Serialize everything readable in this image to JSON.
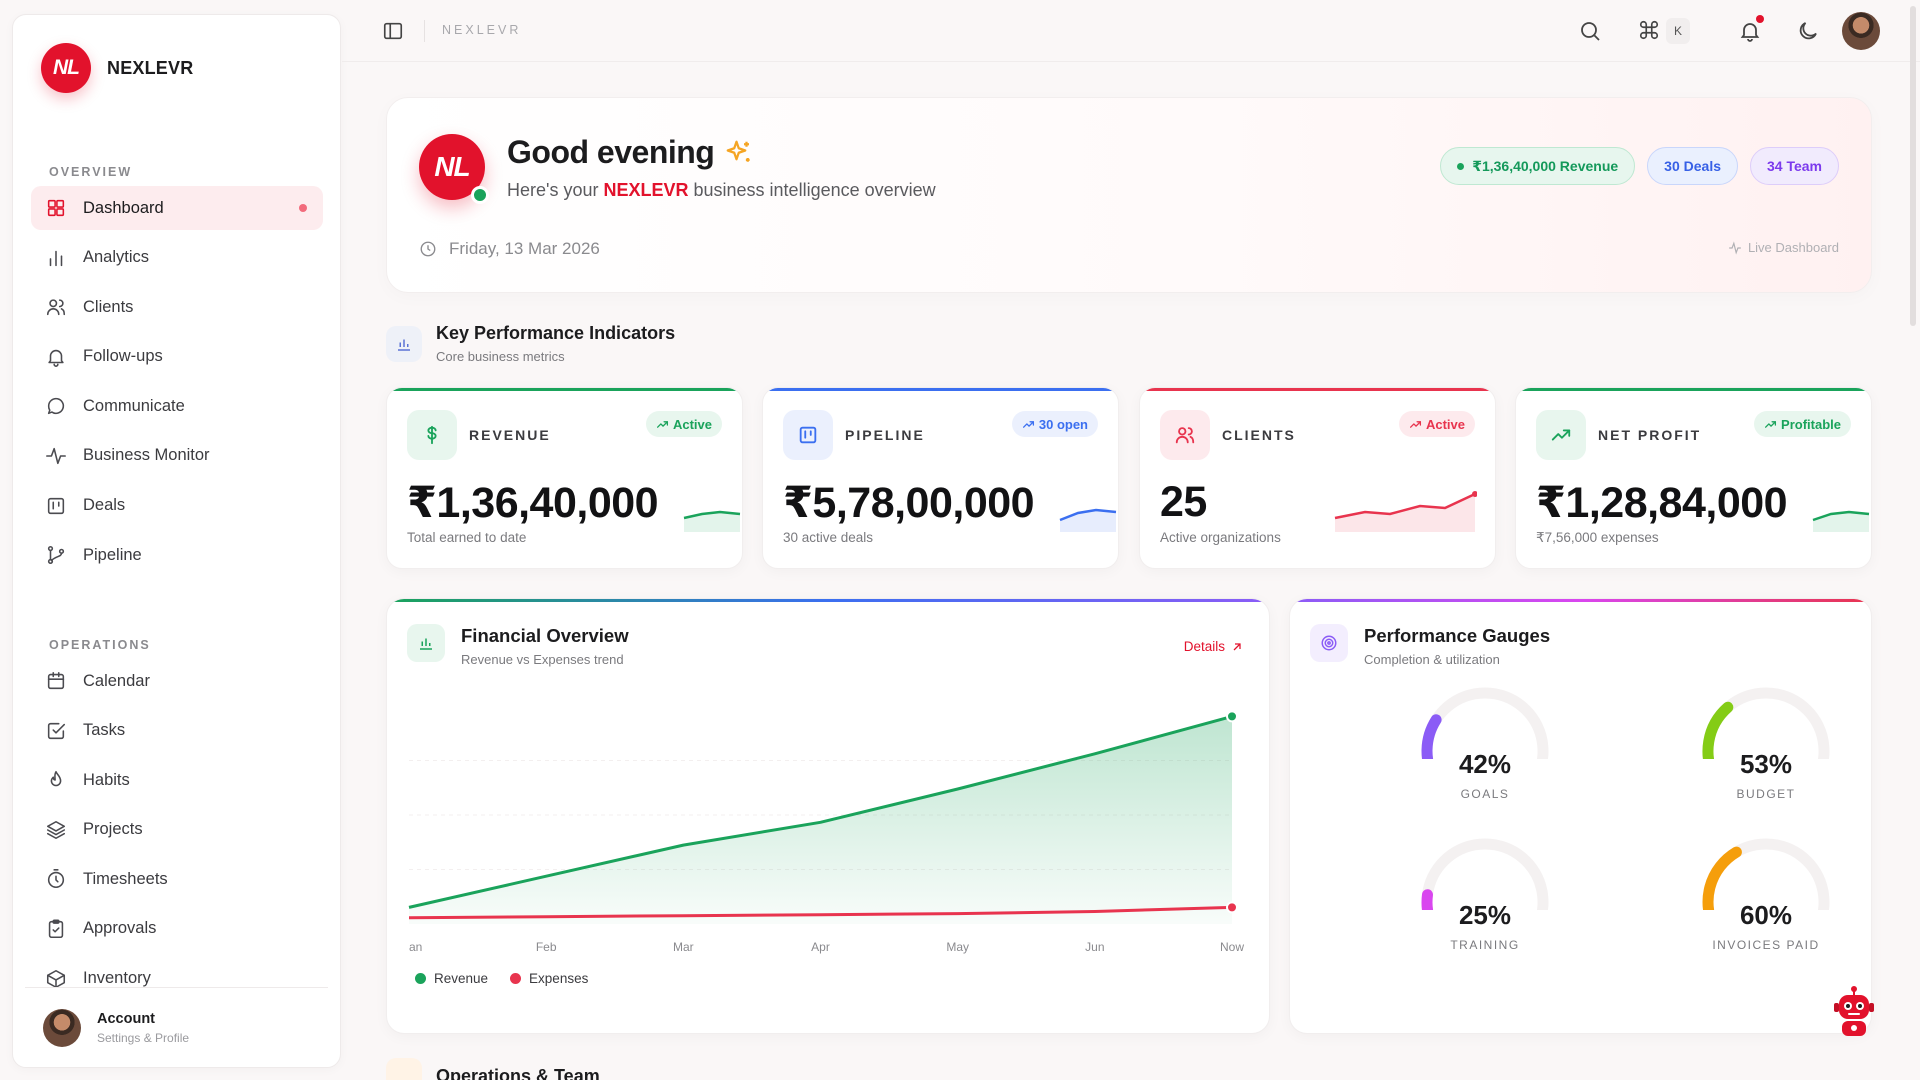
{
  "app": {
    "name": "NEXLEVR",
    "logo_text": "NL"
  },
  "sidebar": {
    "overview_label": "OVERVIEW",
    "operations_label": "OPERATIONS",
    "overview_items": [
      {
        "label": "Dashboard",
        "icon": "grid-icon",
        "active": true
      },
      {
        "label": "Analytics",
        "icon": "bar-chart-icon"
      },
      {
        "label": "Clients",
        "icon": "users-icon"
      },
      {
        "label": "Follow-ups",
        "icon": "bell-icon"
      },
      {
        "label": "Communicate",
        "icon": "message-icon"
      },
      {
        "label": "Business Monitor",
        "icon": "activity-icon"
      },
      {
        "label": "Deals",
        "icon": "kanban-icon"
      },
      {
        "label": "Pipeline",
        "icon": "git-branch-icon"
      }
    ],
    "operations_items": [
      {
        "label": "Calendar",
        "icon": "calendar-icon"
      },
      {
        "label": "Tasks",
        "icon": "checkbox-icon"
      },
      {
        "label": "Habits",
        "icon": "flame-icon"
      },
      {
        "label": "Projects",
        "icon": "layers-icon"
      },
      {
        "label": "Timesheets",
        "icon": "timer-icon"
      },
      {
        "label": "Approvals",
        "icon": "clipboard-check-icon"
      },
      {
        "label": "Inventory",
        "icon": "box-icon"
      }
    ],
    "account": {
      "name": "Account",
      "sub": "Settings & Profile"
    }
  },
  "topbar": {
    "title": "NEXLEVR",
    "shortcut_key": "K"
  },
  "hero": {
    "greeting": "Good evening",
    "sub_prefix": "Here's your ",
    "sub_brand": "NEXLEVR",
    "sub_suffix": " business intelligence overview",
    "date": "Friday, 13 Mar 2026",
    "live_label": "Live Dashboard",
    "pills": {
      "revenue": "₹1,36,40,000 Revenue",
      "deals": "30 Deals",
      "team": "34 Team"
    }
  },
  "kpi_section": {
    "title": "Key Performance Indicators",
    "subtitle": "Core business metrics"
  },
  "kpis": [
    {
      "label": "REVENUE",
      "badge": "Active",
      "value": "₹1,36,40,000",
      "sub": "Total earned to date",
      "color": "#1aa35b",
      "icon": "dollar-icon"
    },
    {
      "label": "PIPELINE",
      "badge": "30 open",
      "value": "₹5,78,00,000",
      "sub": "30 active deals",
      "color": "#3b6ff0",
      "icon": "kanban-icon"
    },
    {
      "label": "CLIENTS",
      "badge": "Active",
      "value": "25",
      "sub": "Active organizations",
      "color": "#e8344e",
      "icon": "users-icon"
    },
    {
      "label": "NET PROFIT",
      "badge": "Profitable",
      "value": "₹1,28,84,000",
      "sub": "₹7,56,000 expenses",
      "color": "#1aa35b",
      "icon": "trending-up-icon"
    }
  ],
  "financial": {
    "title": "Financial Overview",
    "subtitle": "Revenue vs Expenses trend",
    "details_label": "Details",
    "legend": {
      "revenue": "Revenue",
      "expenses": "Expenses"
    }
  },
  "chart_data": {
    "type": "area",
    "categories": [
      "Jan",
      "Feb",
      "Mar",
      "Apr",
      "May",
      "Jun",
      "Now"
    ],
    "tick_labels": [
      "an",
      "Feb",
      "Mar",
      "Apr",
      "May",
      "Jun",
      "Now"
    ],
    "series": [
      {
        "name": "Revenue",
        "color": "#1aa35b",
        "values": [
          0.08,
          0.23,
          0.38,
          0.49,
          0.65,
          0.82,
          1.0
        ]
      },
      {
        "name": "Expenses",
        "color": "#e8344e",
        "values": [
          0.03,
          0.035,
          0.04,
          0.045,
          0.05,
          0.06,
          0.08
        ]
      }
    ],
    "ylim": [
      0,
      1.05
    ],
    "grid": false,
    "legend_position": "bottom-left"
  },
  "gauges": {
    "title": "Performance Gauges",
    "subtitle": "Completion & utilization",
    "items": [
      {
        "label": "GOALS",
        "pct_text": "42%",
        "value": 42,
        "color": "#8b5cf6"
      },
      {
        "label": "BUDGET",
        "pct_text": "53%",
        "value": 53,
        "color": "#84cc16"
      },
      {
        "label": "TRAINING",
        "pct_text": "25%",
        "value": 25,
        "color": "#d946ef"
      },
      {
        "label": "INVOICES PAID",
        "pct_text": "60%",
        "value": 60,
        "color": "#f59e0b"
      }
    ]
  },
  "ops_section": {
    "title": "Operations & Team"
  }
}
